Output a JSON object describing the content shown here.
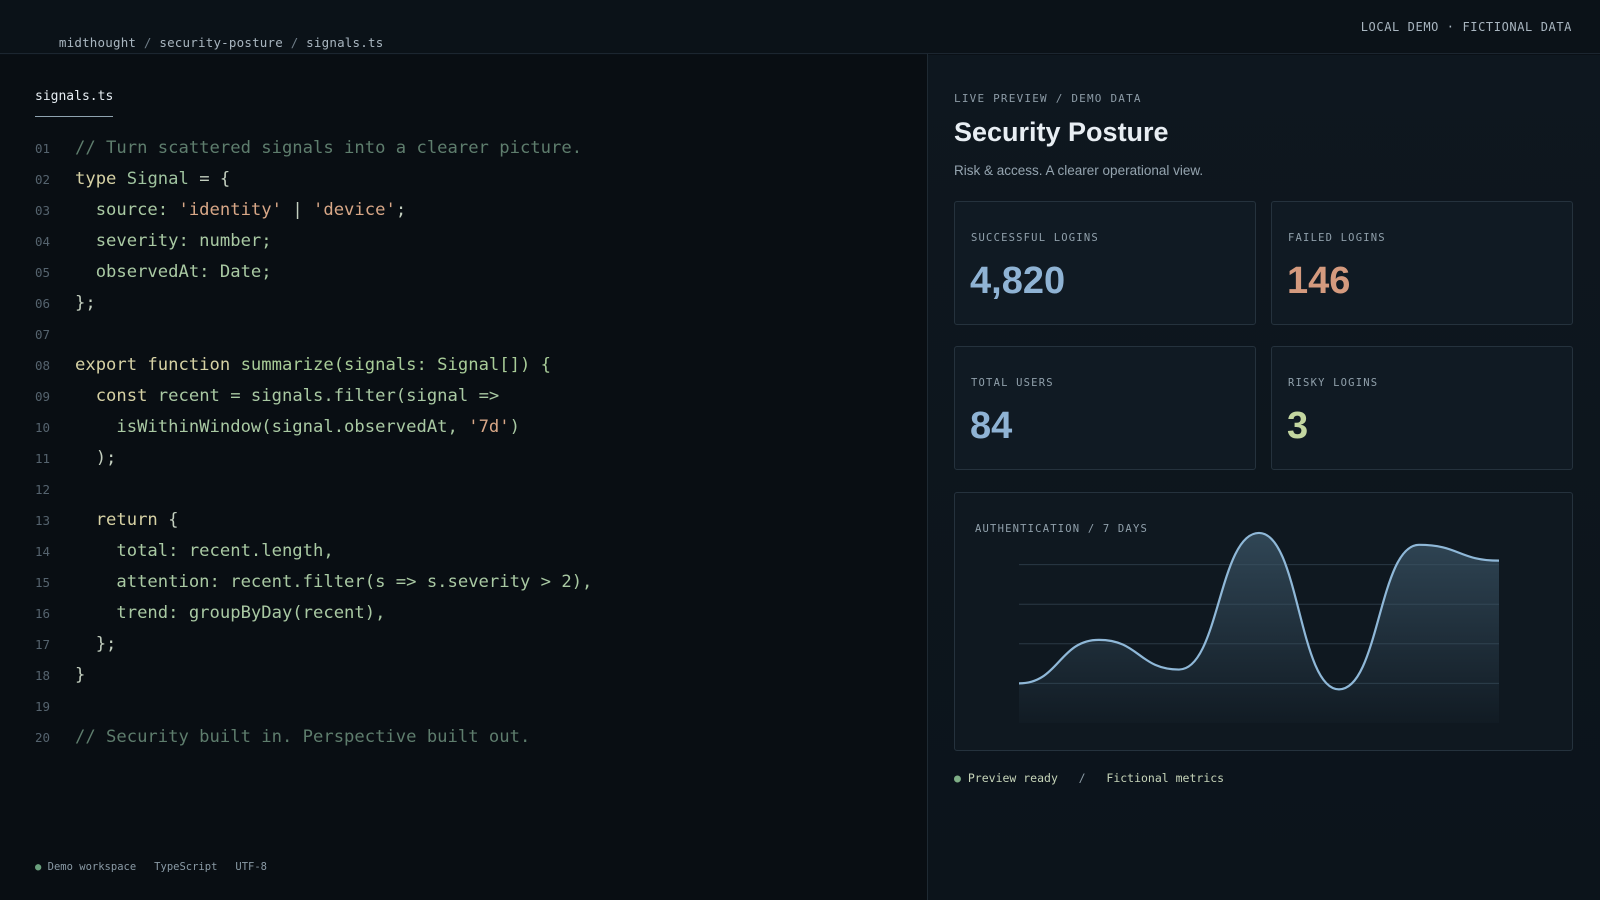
{
  "topbar": {
    "breadcrumb": [
      "midthought",
      "security-posture",
      "signals.ts"
    ],
    "right_label": "LOCAL DEMO · FICTIONAL DATA"
  },
  "editor": {
    "file_tab": "signals.ts",
    "lines": [
      {
        "num": "01",
        "tokens": [
          {
            "t": "// Turn scattered signals into a clearer picture.",
            "k": "comment"
          }
        ]
      },
      {
        "num": "02",
        "tokens": [
          {
            "t": "type ",
            "k": "kw"
          },
          {
            "t": "Signal",
            "k": "id"
          },
          {
            "t": " = {",
            "k": "punc"
          }
        ]
      },
      {
        "num": "03",
        "tokens": [
          {
            "t": "  source: ",
            "k": "plain"
          },
          {
            "t": "'identity'",
            "k": "str"
          },
          {
            "t": " | ",
            "k": "punc"
          },
          {
            "t": "'device'",
            "k": "str"
          },
          {
            "t": ";",
            "k": "punc"
          }
        ]
      },
      {
        "num": "04",
        "tokens": [
          {
            "t": "  severity: number;",
            "k": "plain"
          }
        ]
      },
      {
        "num": "05",
        "tokens": [
          {
            "t": "  observedAt: Date;",
            "k": "plain"
          }
        ]
      },
      {
        "num": "06",
        "tokens": [
          {
            "t": "};",
            "k": "punc"
          }
        ]
      },
      {
        "num": "07",
        "tokens": []
      },
      {
        "num": "08",
        "tokens": [
          {
            "t": "export function ",
            "k": "kw"
          },
          {
            "t": "summarize(signals: Signal[]) {",
            "k": "fn"
          }
        ]
      },
      {
        "num": "09",
        "tokens": [
          {
            "t": "  const ",
            "k": "kw"
          },
          {
            "t": "recent = signals.filter(signal =>",
            "k": "plain"
          }
        ]
      },
      {
        "num": "10",
        "tokens": [
          {
            "t": "    isWithinWindow(signal.observedAt, ",
            "k": "plain"
          },
          {
            "t": "'7d'",
            "k": "str"
          },
          {
            "t": ")",
            "k": "plain"
          }
        ]
      },
      {
        "num": "11",
        "tokens": [
          {
            "t": "  );",
            "k": "punc"
          }
        ]
      },
      {
        "num": "12",
        "tokens": []
      },
      {
        "num": "13",
        "tokens": [
          {
            "t": "  return ",
            "k": "kw"
          },
          {
            "t": "{",
            "k": "punc"
          }
        ]
      },
      {
        "num": "14",
        "tokens": [
          {
            "t": "    total: recent.length,",
            "k": "plain"
          }
        ]
      },
      {
        "num": "15",
        "tokens": [
          {
            "t": "    attention: recent.filter(s => s.severity > 2),",
            "k": "plain"
          }
        ]
      },
      {
        "num": "16",
        "tokens": [
          {
            "t": "    trend: groupByDay(recent),",
            "k": "plain"
          }
        ]
      },
      {
        "num": "17",
        "tokens": [
          {
            "t": "  };",
            "k": "punc"
          }
        ]
      },
      {
        "num": "18",
        "tokens": [
          {
            "t": "}",
            "k": "punc"
          }
        ]
      },
      {
        "num": "19",
        "tokens": []
      },
      {
        "num": "20",
        "tokens": [
          {
            "t": "// Security built in. Perspective built out.",
            "k": "comment"
          }
        ]
      }
    ],
    "status": {
      "dot": "●",
      "workspace": "Demo workspace",
      "language": "TypeScript",
      "encoding": "UTF-8"
    }
  },
  "preview": {
    "kicker": "LIVE PREVIEW / DEMO DATA",
    "title": "Security Posture",
    "subtitle": "Risk & access. A clearer operational view.",
    "cards": [
      {
        "label": "SUCCESSFUL LOGINS",
        "value": "4,820",
        "color": "#8fb3d4"
      },
      {
        "label": "FAILED LOGINS",
        "value": "146",
        "color": "#d49a7e"
      },
      {
        "label": "TOTAL USERS",
        "value": "84",
        "color": "#8fb3d4"
      },
      {
        "label": "RISKY LOGINS",
        "value": "3",
        "color": "#c3d6a0"
      }
    ],
    "chart_label": "AUTHENTICATION / 7 DAYS",
    "footer": {
      "dot": "●",
      "status": "Preview ready",
      "sep": "/",
      "note": "Fictional metrics"
    }
  },
  "chart_data": {
    "type": "area",
    "title": "AUTHENTICATION / 7 DAYS",
    "x": [
      1,
      2,
      3,
      4,
      5,
      6,
      7
    ],
    "values": [
      1.0,
      2.1,
      1.35,
      4.8,
      0.85,
      4.5,
      4.1
    ],
    "ylim": [
      0,
      5
    ],
    "gridlines": [
      1,
      2,
      3,
      4
    ],
    "grid": true,
    "line_color": "#8fb8d8",
    "fill_color": "#3b5567"
  }
}
